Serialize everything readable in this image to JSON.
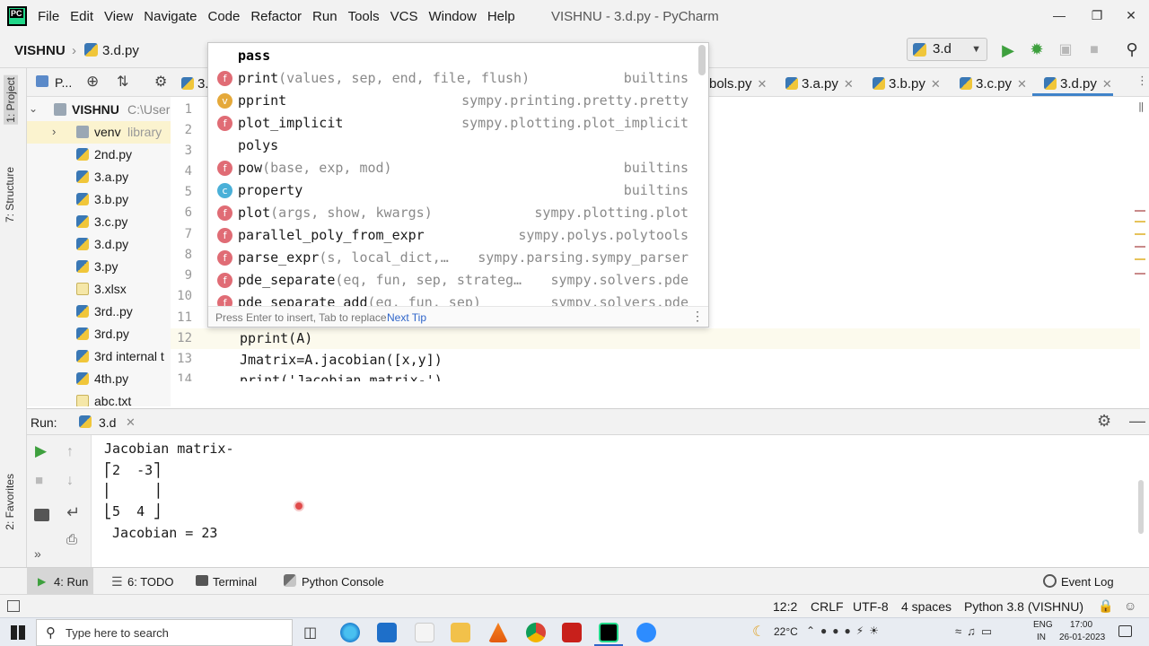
{
  "menubar": {
    "items": [
      "File",
      "Edit",
      "View",
      "Navigate",
      "Code",
      "Refactor",
      "Run",
      "Tools",
      "VCS",
      "Window",
      "Help"
    ],
    "window_title": "VISHNU - 3.d.py - PyCharm"
  },
  "navbar": {
    "project": "VISHNU",
    "file": "3.d.py",
    "run_config": "3.d"
  },
  "left_stripe": {
    "project_tab": "1: Project",
    "structure_tab": "7: Structure",
    "favorites_tab": "2: Favorites"
  },
  "project_panel": {
    "title": "P...",
    "root_name": "VISHNU",
    "root_path": "C:\\User",
    "items": [
      {
        "name": "venv",
        "hint": "library",
        "type": "folder"
      },
      {
        "name": "2nd.py",
        "type": "py"
      },
      {
        "name": "3.a.py",
        "type": "py"
      },
      {
        "name": "3.b.py",
        "type": "py"
      },
      {
        "name": "3.c.py",
        "type": "py"
      },
      {
        "name": "3.d.py",
        "type": "py"
      },
      {
        "name": "3.py",
        "type": "py"
      },
      {
        "name": "3.xlsx",
        "type": "file"
      },
      {
        "name": "3rd..py",
        "type": "py"
      },
      {
        "name": "3rd.py",
        "type": "py"
      },
      {
        "name": "3rd internal t",
        "type": "py"
      },
      {
        "name": "4th.py",
        "type": "py"
      },
      {
        "name": "abc.txt",
        "type": "file"
      }
    ]
  },
  "editor_tabs": {
    "partial_left": "3.",
    "tabs": [
      "bols.py",
      "3.a.py",
      "3.b.py",
      "3.c.py",
      "3.d.py"
    ],
    "active": "3.d.py"
  },
  "editor": {
    "line_numbers": [
      "1",
      "2",
      "3",
      "4",
      "5",
      "6",
      "7",
      "8",
      "9",
      "10",
      "11",
      "12",
      "13",
      "14"
    ],
    "code": {
      "line12": "pprint(A)",
      "line13": "Jmatrix=A.jacobian([x,y])",
      "line14": "print('Jacobian matrix-')"
    }
  },
  "completion": {
    "typed": "p",
    "items": [
      {
        "kind": "",
        "name": "pass",
        "sig": "",
        "source": ""
      },
      {
        "kind": "f",
        "name": "print",
        "sig": "(values, sep, end, file, flush)",
        "source": "builtins"
      },
      {
        "kind": "v",
        "name": "pprint",
        "sig": "",
        "source": "sympy.printing.pretty.pretty"
      },
      {
        "kind": "f",
        "name": "plot_implicit",
        "sig": "",
        "source": "sympy.plotting.plot_implicit"
      },
      {
        "kind": "",
        "name": "polys",
        "sig": "",
        "source": ""
      },
      {
        "kind": "f",
        "name": "pow",
        "sig": "(base, exp, mod)",
        "source": "builtins"
      },
      {
        "kind": "c",
        "name": "property",
        "sig": "",
        "source": "builtins"
      },
      {
        "kind": "f",
        "name": "plot",
        "sig": "(args, show, kwargs)",
        "source": "sympy.plotting.plot"
      },
      {
        "kind": "f",
        "name": "parallel_poly_from_expr",
        "sig": "",
        "source": "sympy.polys.polytools"
      },
      {
        "kind": "f",
        "name": "parse_expr",
        "sig": "(s, local_dict,…",
        "source": "sympy.parsing.sympy_parser"
      },
      {
        "kind": "f",
        "name": "pde_separate",
        "sig": "(eq, fun, sep, strateg…",
        "source": "sympy.solvers.pde"
      },
      {
        "kind": "f",
        "name": "pde_separate_add",
        "sig": "(eq, fun, sep)",
        "source": "sympy.solvers.pde"
      }
    ],
    "footer_hint": "Press Enter to insert, Tab to replace",
    "footer_link": "Next Tip"
  },
  "run_panel": {
    "label": "Run:",
    "tab": "3.d",
    "output": [
      "Jacobian matrix-",
      "⎡2  -3⎤",
      "⎢     ⎥",
      "⎣5  4 ⎦",
      " Jacobian = 23"
    ]
  },
  "tool_tabs": {
    "run": "4: Run",
    "todo": "6: TODO",
    "terminal": "Terminal",
    "python_console": "Python Console",
    "event_log": "Event Log"
  },
  "statusbar": {
    "position": "12:2",
    "line_sep": "CRLF",
    "encoding": "UTF-8",
    "indent": "4 spaces",
    "interpreter": "Python 3.8 (VISHNU)"
  },
  "taskbar": {
    "search_placeholder": "Type here to search",
    "weather": "22°C",
    "lang_top": "ENG",
    "lang_bottom": "IN",
    "time": "17:00",
    "date": "26-01-2023"
  },
  "colors": {
    "accent": "#2f65ca",
    "run_green": "#3ea03e",
    "keyword_fn": "#e06c75"
  }
}
